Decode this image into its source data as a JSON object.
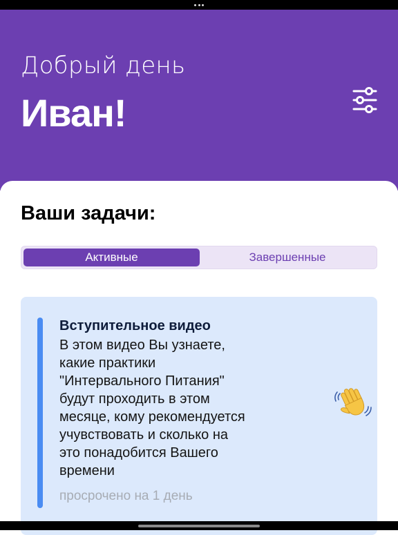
{
  "header": {
    "greeting": "Добрый день",
    "username": "Иван!"
  },
  "tasks": {
    "title": "Ваши задачи:",
    "tabs": [
      {
        "label": "Активные",
        "selected": true
      },
      {
        "label": "Завершенные",
        "selected": false
      }
    ]
  },
  "task_card": {
    "title": "Вступительное видео",
    "description": "В этом видео Вы узнаете,\nкакие практики\n\"Интервального Питания\"\nбудут проходить в этом\nмесяце, кому рекомендуется\nучувствовать и сколько на\nэто понадобится Вашего\nвремени",
    "status": "просрочено на 1 день",
    "emoji": "waving-hand-icon"
  },
  "colors": {
    "primary": "#6c3fb1",
    "card_bg": "#dce9fc",
    "accent": "#4a8cf2",
    "status_text": "#a7acb4"
  }
}
